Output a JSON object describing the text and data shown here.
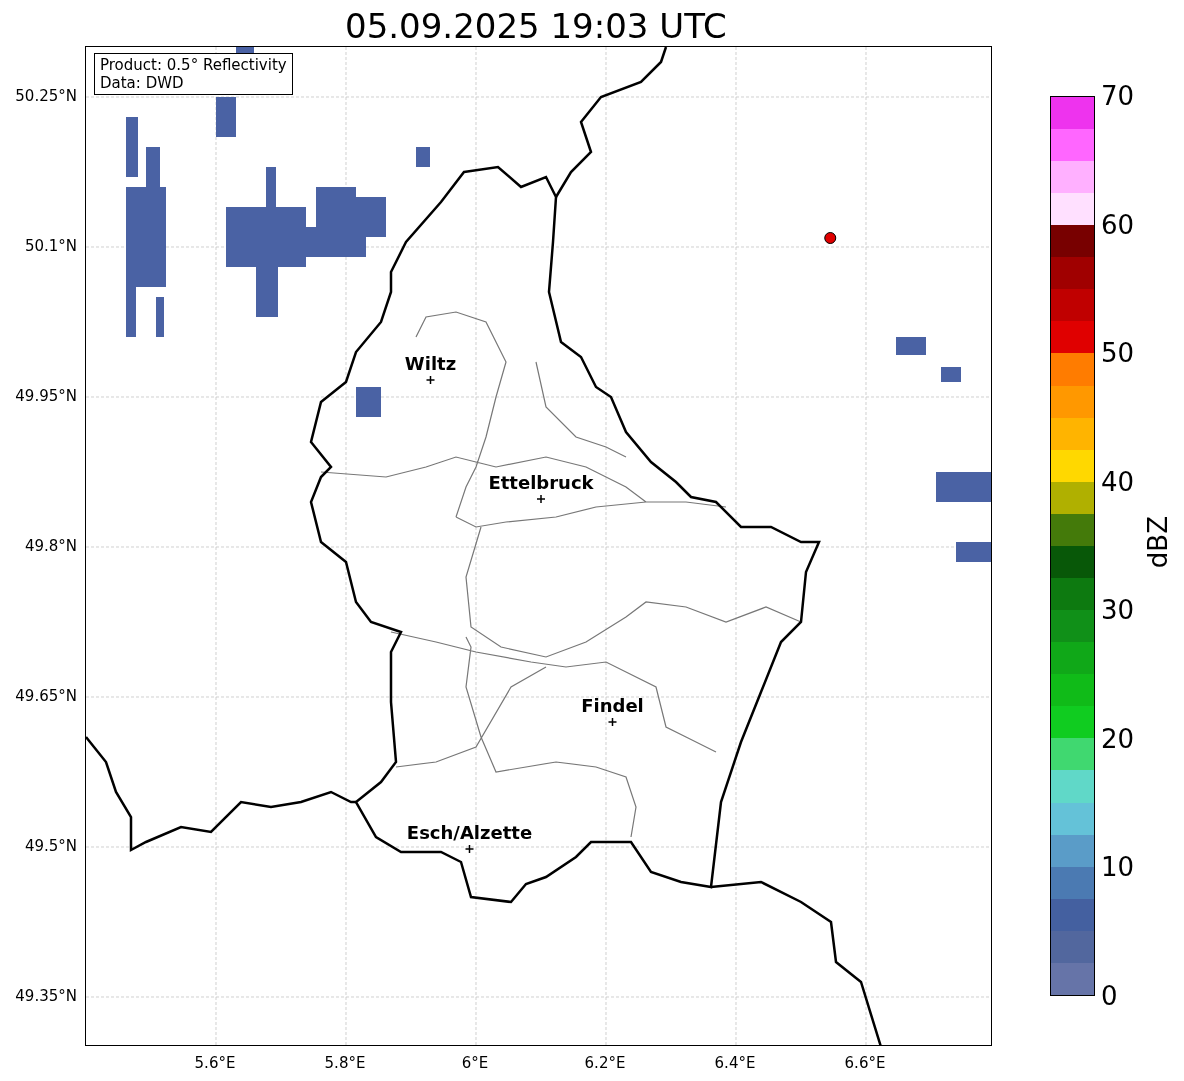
{
  "title": "05.09.2025 19:03 UTC",
  "info_box": [
    "Product: 0.5° Reflectivity",
    "Data: DWD"
  ],
  "map": {
    "yticks": [
      "50.25°N",
      "50.1°N",
      "49.95°N",
      "49.8°N",
      "49.65°N",
      "49.5°N",
      "49.35°N"
    ],
    "xticks": [
      "5.6°E",
      "5.8°E",
      "6°E",
      "6.2°E",
      "6.4°E",
      "6.6°E"
    ],
    "cities": [
      {
        "name": "Wiltz"
      },
      {
        "name": "Ettelbruck"
      },
      {
        "name": "Findel"
      },
      {
        "name": "Esch/Alzette"
      }
    ],
    "stations": [
      {
        "color": "#e00000"
      }
    ]
  },
  "colorbar": {
    "label": "dBZ",
    "ticks": [
      "70",
      "60",
      "50",
      "40",
      "30",
      "20",
      "10",
      "0"
    ],
    "bins": [
      {
        "color": "#6674a8"
      },
      {
        "color": "#52679e"
      },
      {
        "color": "#4460a0"
      },
      {
        "color": "#4b7ab2"
      },
      {
        "color": "#5a9cc8"
      },
      {
        "color": "#64c2d8"
      },
      {
        "color": "#60d8c8"
      },
      {
        "color": "#40d870"
      },
      {
        "color": "#10cc20"
      },
      {
        "color": "#10bb18"
      },
      {
        "color": "#10a818"
      },
      {
        "color": "#109018"
      },
      {
        "color": "#0d7a10"
      },
      {
        "color": "#085808"
      },
      {
        "color": "#447a0a"
      },
      {
        "color": "#b0b000"
      },
      {
        "color": "#ffd800"
      },
      {
        "color": "#ffb400"
      },
      {
        "color": "#ff9800"
      },
      {
        "color": "#ff7c00"
      },
      {
        "color": "#e00000"
      },
      {
        "color": "#c00000"
      },
      {
        "color": "#a00000"
      },
      {
        "color": "#780000"
      },
      {
        "color": "#ffe0ff"
      },
      {
        "color": "#ffb0ff"
      },
      {
        "color": "#ff66ff"
      },
      {
        "color": "#ee33ee"
      }
    ]
  }
}
